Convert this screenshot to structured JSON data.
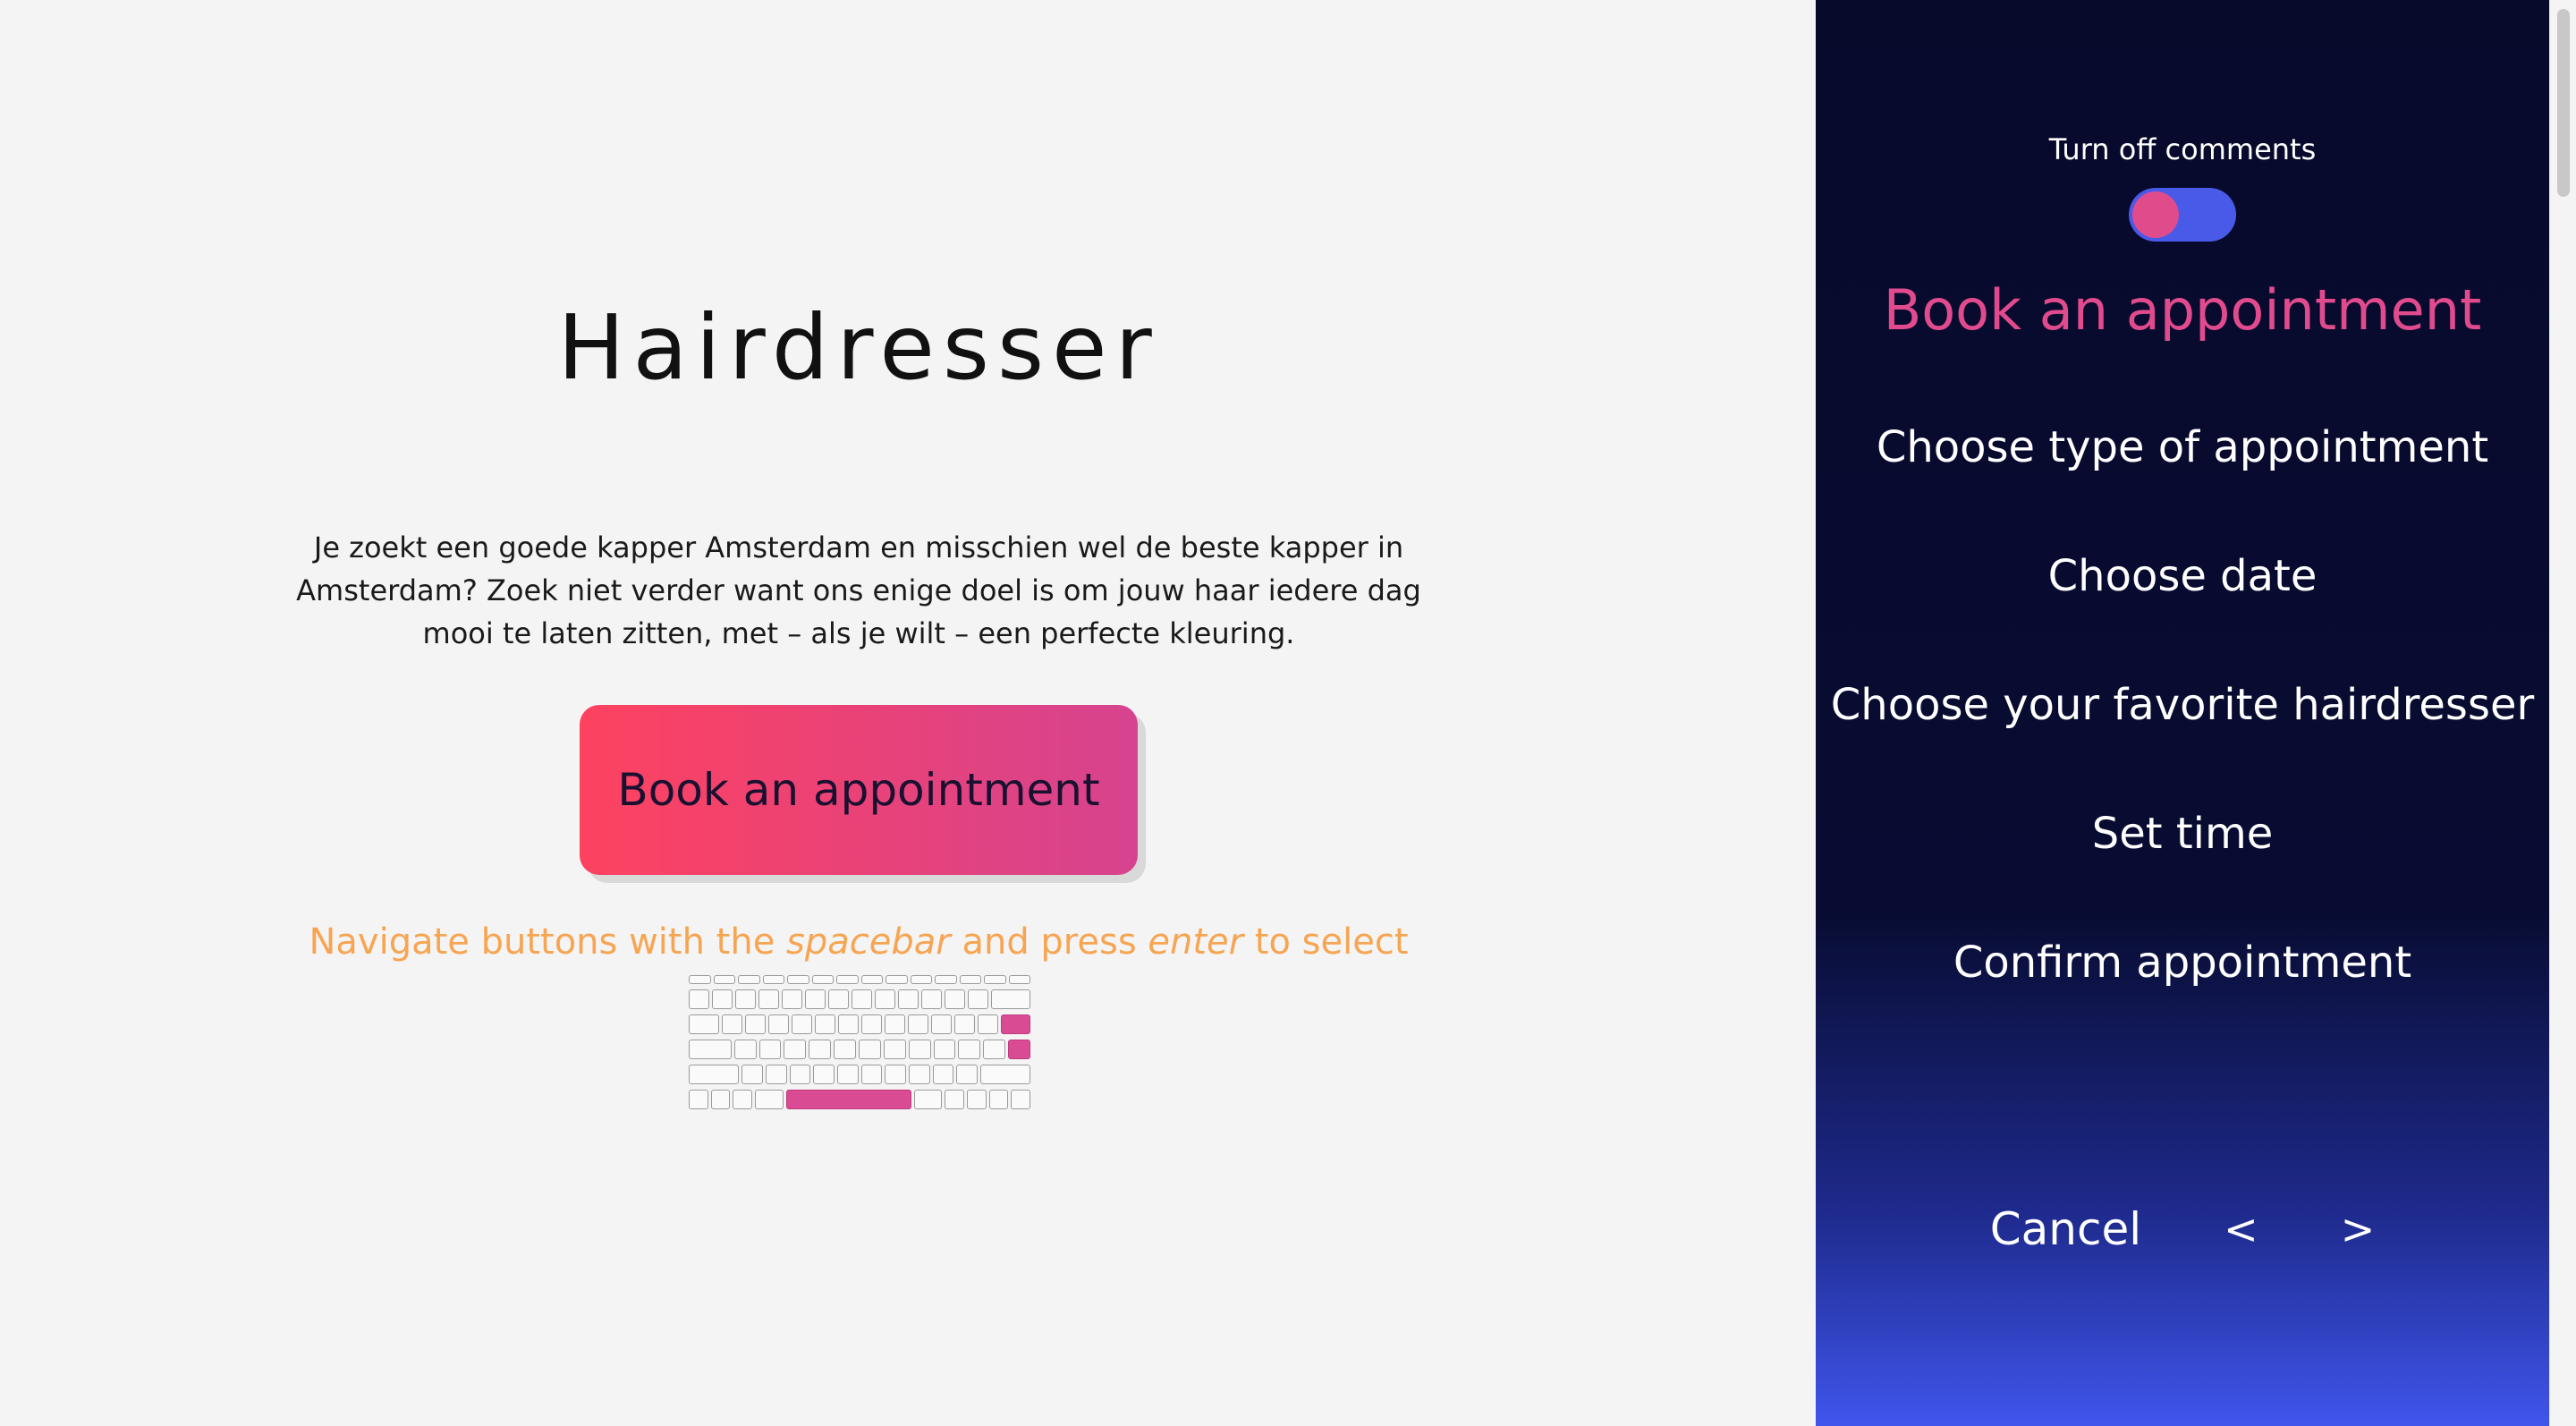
{
  "main": {
    "title": "Hairdresser",
    "intro": "Je zoekt een goede kapper Amsterdam en misschien wel de beste kapper in Amsterdam? Zoek niet verder want ons enige doel is om jouw haar iedere dag mooi te laten zitten, met – als je wilt – een perfecte kleuring.",
    "cta_label": "Book an appointment",
    "hint": {
      "part1": "Navigate buttons with the ",
      "key1": "spacebar",
      "part2": " and press ",
      "key2": "enter",
      "part3": " to select"
    },
    "keyboard_icon": "keyboard-icon"
  },
  "sidebar": {
    "toggle_label": "Turn off comments",
    "heading": "Book an appointment",
    "steps": [
      "Choose type of appointment",
      "Choose date",
      "Choose your favorite hairdresser",
      "Set time",
      "Confirm appointment"
    ],
    "cancel_label": "Cancel",
    "prev_label": "<",
    "next_label": ">"
  },
  "colors": {
    "accent_pink": "#e14b8e",
    "cta_gradient_start": "#fd4260",
    "cta_gradient_end": "#d6438f",
    "hint_orange": "#f7a552",
    "sidebar_dark": "#070a2b",
    "sidebar_blue": "#3f55ec"
  }
}
